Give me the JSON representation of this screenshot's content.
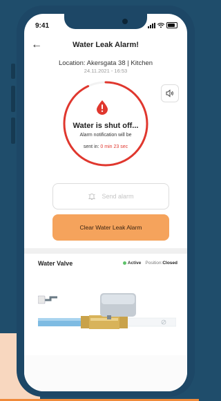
{
  "status_bar": {
    "time": "9:41"
  },
  "header": {
    "title": "Water Leak Alarm!"
  },
  "location": {
    "text": "Location: Akersgata 38 | Kitchen",
    "datetime": "24.11.2021 - 16:53"
  },
  "alarm": {
    "headline": "Water is shut off...",
    "subtitle": "Alarm notification will be",
    "sent_in_label": "sent in:",
    "timer": "0 min 23 sec",
    "countdown_fraction": 0.93
  },
  "actions": {
    "send_alarm": "Send alarm",
    "clear_alarm": "Clear Water Leak Alarm"
  },
  "valve": {
    "title": "Water Valve",
    "status": "Active",
    "position_label": "Position:",
    "position_value": "Closed"
  },
  "colors": {
    "accent_red": "#e0372e",
    "accent_orange": "#f5a35c",
    "frame": "#1d4766",
    "background": "#1f4d6b",
    "active_green": "#5ec26a"
  }
}
